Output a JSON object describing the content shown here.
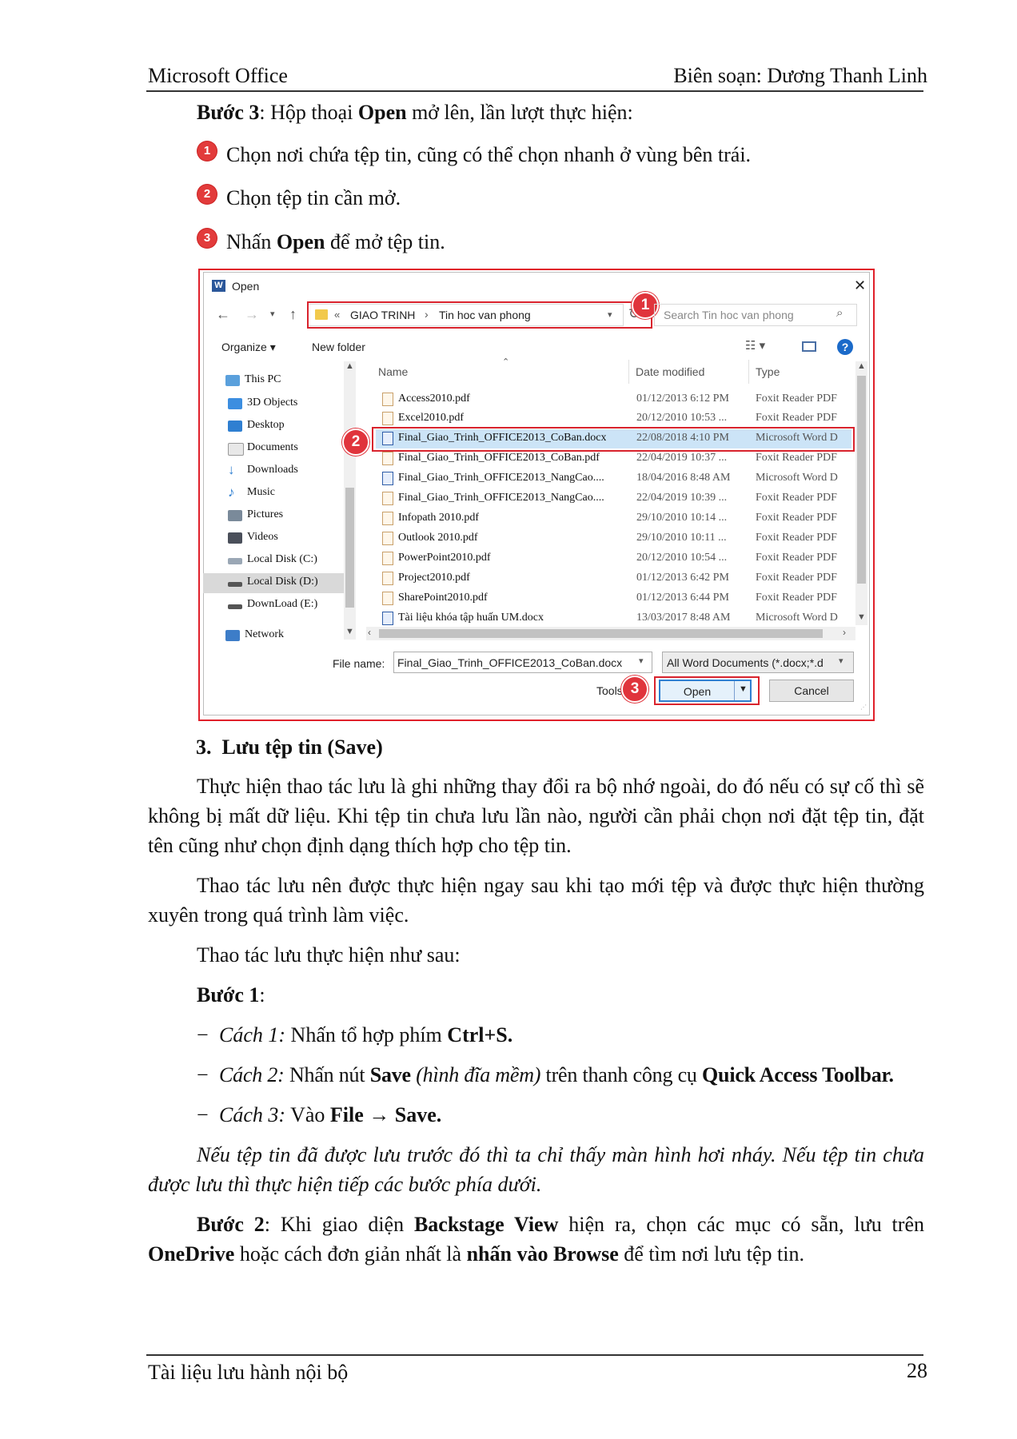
{
  "header": {
    "left": "Microsoft Office",
    "right": "Biên soạn: Dương Thanh Linh"
  },
  "step3": {
    "label": "Bước 3",
    "text_a": ": Hộp thoại ",
    "open_word": "Open",
    "text_b": " mở lên, lần lượt thực hiện:"
  },
  "bullets": {
    "b1_num": "1",
    "b1_text": "Chọn nơi chứa tệp tin, cũng có thể chọn nhanh ở vùng bên trái.",
    "b2_num": "2",
    "b2_text": "Chọn tệp tin cần mở.",
    "b3_num": "3",
    "b3_a": "Nhấn ",
    "b3_open": "Open",
    "b3_b": " để mở tệp tin."
  },
  "dialog": {
    "title": "Open",
    "close": "✕",
    "breadcrumb": {
      "chev": "«",
      "part1": "GIAO TRINH",
      "sep": "›",
      "part2": "Tin hoc van phong"
    },
    "search_placeholder": "Search Tin hoc van phong",
    "organize": "Organize ▾",
    "new_folder": "New folder",
    "nav_items": [
      "This PC",
      "3D Objects",
      "Desktop",
      "Documents",
      "Downloads",
      "Music",
      "Pictures",
      "Videos",
      "Local Disk (C:)",
      "Local Disk (D:)",
      "DownLoad (E:)",
      "Network"
    ],
    "columns": {
      "name": "Name",
      "date": "Date modified",
      "type": "Type"
    },
    "files": [
      {
        "name": "Access2010.pdf",
        "date": "01/12/2013 6:12 PM",
        "type": "Foxit Reader PDF"
      },
      {
        "name": "Excel2010.pdf",
        "date": "20/12/2010 10:53 ...",
        "type": "Foxit Reader PDF"
      },
      {
        "name": "Final_Giao_Trinh_OFFICE2013_CoBan.docx",
        "date": "22/08/2018 4:10 PM",
        "type": "Microsoft Word D"
      },
      {
        "name": "Final_Giao_Trinh_OFFICE2013_CoBan.pdf",
        "date": "22/04/2019 10:37 ...",
        "type": "Foxit Reader PDF"
      },
      {
        "name": "Final_Giao_Trinh_OFFICE2013_NangCao....",
        "date": "18/04/2016 8:48 AM",
        "type": "Microsoft Word D"
      },
      {
        "name": "Final_Giao_Trinh_OFFICE2013_NangCao....",
        "date": "22/04/2019 10:39 ...",
        "type": "Foxit Reader PDF"
      },
      {
        "name": "Infopath 2010.pdf",
        "date": "29/10/2010 10:14 ...",
        "type": "Foxit Reader PDF"
      },
      {
        "name": "Outlook 2010.pdf",
        "date": "29/10/2010 10:11 ...",
        "type": "Foxit Reader PDF"
      },
      {
        "name": "PowerPoint2010.pdf",
        "date": "20/12/2010 10:54 ...",
        "type": "Foxit Reader PDF"
      },
      {
        "name": "Project2010.pdf",
        "date": "01/12/2013 6:42 PM",
        "type": "Foxit Reader PDF"
      },
      {
        "name": "SharePoint2010.pdf",
        "date": "01/12/2013 6:44 PM",
        "type": "Foxit Reader PDF"
      },
      {
        "name": "Tài liệu khóa tập huấn UM.docx",
        "date": "13/03/2017 8:48 AM",
        "type": "Microsoft Word D"
      }
    ],
    "file_name_label": "File name:",
    "file_name_value": "Final_Giao_Trinh_OFFICE2013_CoBan.docx",
    "file_type": "All Word Documents (*.docx;*.d",
    "tools": "Tools",
    "open_btn": "Open",
    "cancel_btn": "Cancel",
    "badge1": "1",
    "badge2": "2",
    "badge3": "3"
  },
  "section": {
    "num": "3.",
    "title": "Lưu tệp tin (Save)"
  },
  "para1": "Thực hiện thao tác lưu là ghi những thay đổi ra bộ nhớ ngoài, do đó nếu có sự cố thì sẽ không bị mất dữ liệu. Khi tệp tin chưa lưu lần nào, người cần phải chọn nơi đặt tệp tin, đặt tên cũng như chọn định dạng thích hợp cho tệp tin.",
  "para2": "Thao tác lưu nên được thực hiện ngay sau khi tạo mới tệp và được thực hiện thường xuyên trong quá trình làm việc.",
  "para3": "Thao tác lưu thực hiện như sau:",
  "step1": {
    "label": "Bước 1",
    "colon": ":"
  },
  "ways": {
    "dash": "−",
    "w1_label": "Cách 1:",
    "w1_text": " Nhấn tổ hợp phím ",
    "w1_key": "Ctrl+S.",
    "w2_label": "Cách 2:",
    "w2_text": " Nhấn nút ",
    "w2_save": "Save",
    "w2_italic": " (hình đĩa mềm)",
    "w2_text2": " trên thanh công cụ ",
    "w2_bold": "Quick Access Toolbar.",
    "w3_label": "Cách 3:",
    "w3_text": " Vào ",
    "w3_bold": "File → Save."
  },
  "note": "Nếu tệp tin đã được lưu trước đó thì ta chỉ thấy màn hình hơi nháy. Nếu tệp tin chưa được lưu thì thực hiện tiếp các bước phía dưới.",
  "step2": {
    "label": "Bước 2",
    "a": ": Khi giao diện ",
    "b1": "Backstage View",
    "c": " hiện ra, chọn các mục có sẵn, lưu trên ",
    "b2": "OneDrive",
    "d": " hoặc cách đơn giản nhất là ",
    "b3": "nhấn vào Browse",
    "e": " để tìm nơi lưu tệp tin."
  },
  "footer": {
    "left": "Tài liệu lưu hành nội bộ",
    "page": "28"
  }
}
